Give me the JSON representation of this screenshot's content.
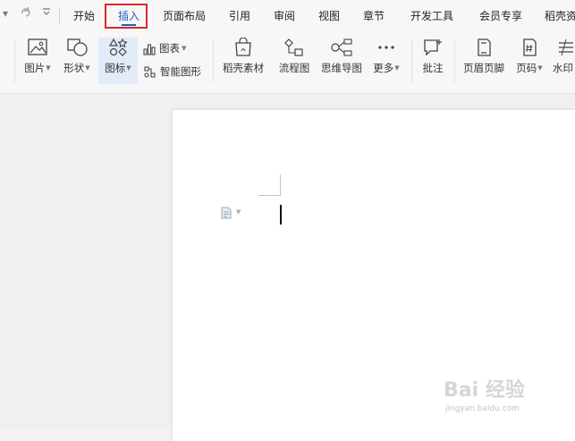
{
  "quick_access": {
    "redo_icon": "redo-icon",
    "more_icon": "chevron-down-icon"
  },
  "menu": {
    "tabs": [
      {
        "label": "开始"
      },
      {
        "label": "插入"
      },
      {
        "label": "页面布局"
      },
      {
        "label": "引用"
      },
      {
        "label": "审阅"
      },
      {
        "label": "视图"
      },
      {
        "label": "章节"
      },
      {
        "label": "开发工具"
      },
      {
        "label": "会员专享"
      },
      {
        "label": "稻壳资"
      }
    ],
    "active_tab": "插入",
    "highlight_color": "#d52b2b",
    "accent_color": "#1e5fc8"
  },
  "ribbon": {
    "picture": "图片",
    "shape": "形状",
    "icon": "图标",
    "chart": "图表",
    "smart_art": "智能图形",
    "docer_material": "稻壳素材",
    "flowchart": "流程图",
    "mind_map": "思维导图",
    "more": "更多",
    "comment": "批注",
    "header_footer": "页眉页脚",
    "page_number": "页码",
    "watermark": "水印"
  },
  "watermark": {
    "text": "Bai 经验",
    "url": "jingyan.baidu.com"
  }
}
